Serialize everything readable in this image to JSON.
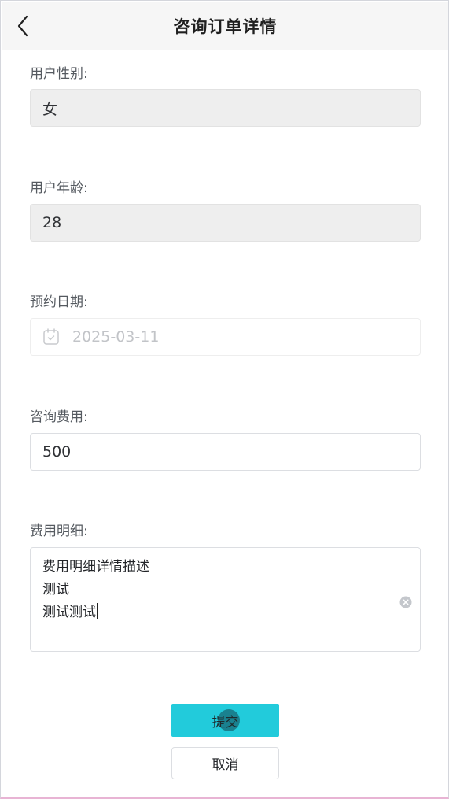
{
  "header": {
    "title": "咨询订单详情",
    "back_icon": "chevron-left-icon"
  },
  "form": {
    "gender": {
      "label": "用户性别:",
      "value": "女"
    },
    "age": {
      "label": "用户年龄:",
      "value": "28"
    },
    "date": {
      "label": "预约日期:",
      "value": "2025-03-11",
      "icon": "calendar-icon"
    },
    "fee": {
      "label": "咨询费用:",
      "value": "500"
    },
    "fee_detail": {
      "label": "费用明细:",
      "lines": [
        "费用明细详情描述",
        "测试",
        "测试测试"
      ],
      "clear_icon": "clear-icon"
    }
  },
  "actions": {
    "submit_label": "提交",
    "cancel_label": "取消"
  },
  "colors": {
    "primary": "#22cbdb",
    "header_bg": "#f6f6f6",
    "readonly_bg": "#eeeeee",
    "border": "#dcdee2"
  }
}
